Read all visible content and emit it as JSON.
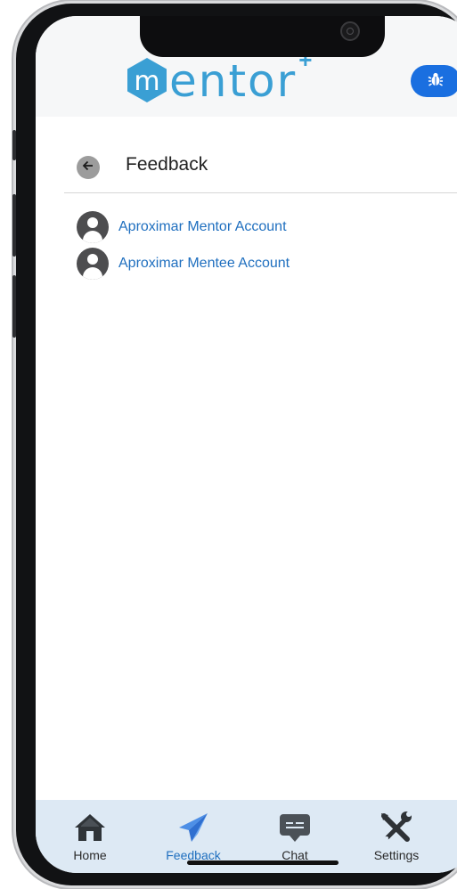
{
  "app": {
    "logo_text": "entor",
    "logo_plus": "+",
    "bug_icon": "bug-icon"
  },
  "page": {
    "title": "Feedback",
    "back_icon": "arrow-left-icon"
  },
  "accounts": [
    {
      "name": "Aproximar Mentor Account",
      "icon": "account-circle-icon"
    },
    {
      "name": "Aproximar Mentee Account",
      "icon": "account-circle-icon"
    }
  ],
  "tabs": [
    {
      "label": "Home",
      "icon": "home-icon",
      "active": false
    },
    {
      "label": "Feedback",
      "icon": "paper-plane-icon",
      "active": true
    },
    {
      "label": "Chat",
      "icon": "chat-icon",
      "active": false
    },
    {
      "label": "Settings",
      "icon": "tools-icon",
      "active": false
    }
  ],
  "colors": {
    "brand": "#3a9fd4",
    "accent": "#1a6fe0",
    "link": "#1f6fbf",
    "tabbar_bg": "#dde9f4"
  }
}
